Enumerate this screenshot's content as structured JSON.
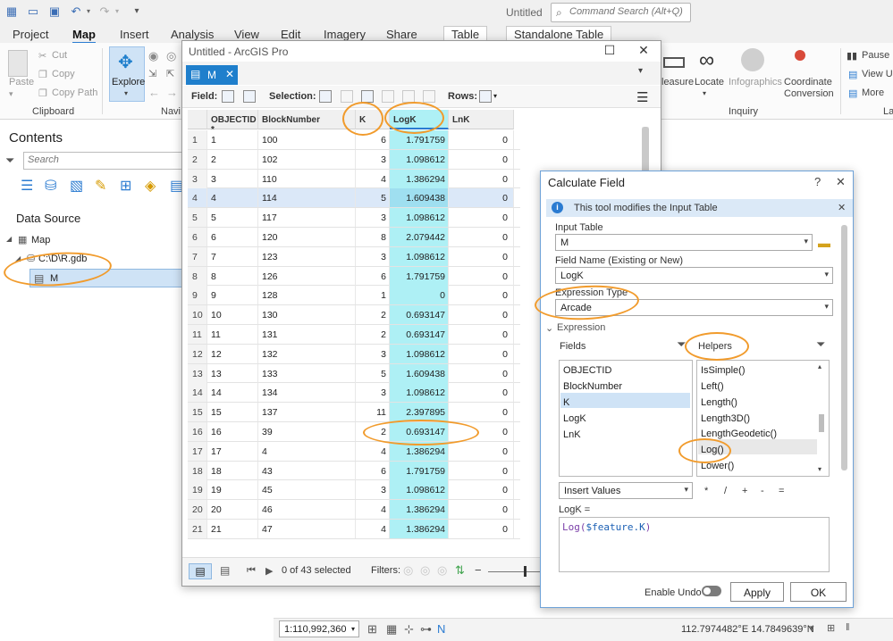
{
  "app": {
    "title": "Untitled",
    "command_search_placeholder": "Command Search (Alt+Q)"
  },
  "ribbon": {
    "tabs": [
      "Project",
      "Map",
      "Insert",
      "Analysis",
      "View",
      "Edit",
      "Imagery",
      "Share",
      "Table",
      "Standalone Table"
    ],
    "active_tab": "Map",
    "clipboard": {
      "paste": "Paste",
      "cut": "Cut",
      "copy": "Copy",
      "copy_path": "Copy Path",
      "group": "Clipboard"
    },
    "navigate": {
      "explore": "Explore",
      "group": "Navi"
    },
    "inquiry": {
      "measure": "leasure",
      "locate": "Locate",
      "infographics": "Infographics",
      "coord1": "Coordinate",
      "coord2": "Conversion",
      "group": "Inquiry"
    },
    "right": {
      "pause": "Pause",
      "view": "View U",
      "more": "More",
      "group": "La"
    }
  },
  "contents": {
    "title": "Contents",
    "search_placeholder": "Search",
    "data_source": "Data Source",
    "tree": {
      "map": "Map",
      "gdb": "C:\\D\\R.gdb",
      "table": "M"
    }
  },
  "attr_window": {
    "title": "Untitled - ArcGIS Pro",
    "tab": "M",
    "toolbar": {
      "field": "Field:",
      "selection": "Selection:",
      "rows": "Rows:"
    },
    "columns": [
      "OBJECTID *",
      "BlockNumber",
      "K",
      "LogK",
      "LnK"
    ],
    "rows": [
      {
        "rn": "1",
        "oid": "1",
        "bn": "100",
        "k": "6",
        "log": "1.791759",
        "ln": "0"
      },
      {
        "rn": "2",
        "oid": "2",
        "bn": "102",
        "k": "3",
        "log": "1.098612",
        "ln": "0"
      },
      {
        "rn": "3",
        "oid": "3",
        "bn": "110",
        "k": "4",
        "log": "1.386294",
        "ln": "0"
      },
      {
        "rn": "4",
        "oid": "4",
        "bn": "114",
        "k": "5",
        "log": "1.609438",
        "ln": "0"
      },
      {
        "rn": "5",
        "oid": "5",
        "bn": "117",
        "k": "3",
        "log": "1.098612",
        "ln": "0"
      },
      {
        "rn": "6",
        "oid": "6",
        "bn": "120",
        "k": "8",
        "log": "2.079442",
        "ln": "0"
      },
      {
        "rn": "7",
        "oid": "7",
        "bn": "123",
        "k": "3",
        "log": "1.098612",
        "ln": "0"
      },
      {
        "rn": "8",
        "oid": "8",
        "bn": "126",
        "k": "6",
        "log": "1.791759",
        "ln": "0"
      },
      {
        "rn": "9",
        "oid": "9",
        "bn": "128",
        "k": "1",
        "log": "0",
        "ln": "0"
      },
      {
        "rn": "10",
        "oid": "10",
        "bn": "130",
        "k": "2",
        "log": "0.693147",
        "ln": "0"
      },
      {
        "rn": "11",
        "oid": "11",
        "bn": "131",
        "k": "2",
        "log": "0.693147",
        "ln": "0"
      },
      {
        "rn": "12",
        "oid": "12",
        "bn": "132",
        "k": "3",
        "log": "1.098612",
        "ln": "0"
      },
      {
        "rn": "13",
        "oid": "13",
        "bn": "133",
        "k": "5",
        "log": "1.609438",
        "ln": "0"
      },
      {
        "rn": "14",
        "oid": "14",
        "bn": "134",
        "k": "3",
        "log": "1.098612",
        "ln": "0"
      },
      {
        "rn": "15",
        "oid": "15",
        "bn": "137",
        "k": "11",
        "log": "2.397895",
        "ln": "0"
      },
      {
        "rn": "16",
        "oid": "16",
        "bn": "39",
        "k": "2",
        "log": "0.693147",
        "ln": "0"
      },
      {
        "rn": "17",
        "oid": "17",
        "bn": "4",
        "k": "4",
        "log": "1.386294",
        "ln": "0"
      },
      {
        "rn": "18",
        "oid": "18",
        "bn": "43",
        "k": "6",
        "log": "1.791759",
        "ln": "0"
      },
      {
        "rn": "19",
        "oid": "19",
        "bn": "45",
        "k": "3",
        "log": "1.098612",
        "ln": "0"
      },
      {
        "rn": "20",
        "oid": "20",
        "bn": "46",
        "k": "4",
        "log": "1.386294",
        "ln": "0"
      },
      {
        "rn": "21",
        "oid": "21",
        "bn": "47",
        "k": "4",
        "log": "1.386294",
        "ln": "0"
      }
    ],
    "status": {
      "selected": "0 of 43 selected",
      "filters": "Filters:"
    }
  },
  "calc": {
    "title": "Calculate Field",
    "help": "?",
    "info": "This tool modifies the Input Table",
    "input_table_label": "Input Table",
    "input_table": "M",
    "field_name_label": "Field Name (Existing or New)",
    "field_name": "LogK",
    "expr_type_label": "Expression Type",
    "expr_type": "Arcade",
    "expression_label": "Expression",
    "fields_label": "Fields",
    "helpers_label": "Helpers",
    "fields": [
      "OBJECTID",
      "BlockNumber",
      "K",
      "LogK",
      "LnK"
    ],
    "helpers": [
      "IsSimple()",
      "Left()",
      "Length()",
      "Length3D()",
      "LengthGeodetic()",
      "Log()",
      "Lower()"
    ],
    "insert_values": "Insert Values",
    "operators": [
      "*",
      "/",
      "+",
      "-",
      "="
    ],
    "expr_target": "LogK =",
    "expr_func": "Log(",
    "expr_var": "$feature.K",
    "expr_close": ")",
    "enable_undo": "Enable Undo",
    "apply": "Apply",
    "ok": "OK"
  },
  "statusbar": {
    "scale": "1:110,992,360",
    "coords": "112.7974482°E 14.7849639°N"
  },
  "colors": {
    "accent": "#1f7fcc",
    "highlight_column": "#aef0f5",
    "annotation": "#f19b2c"
  }
}
